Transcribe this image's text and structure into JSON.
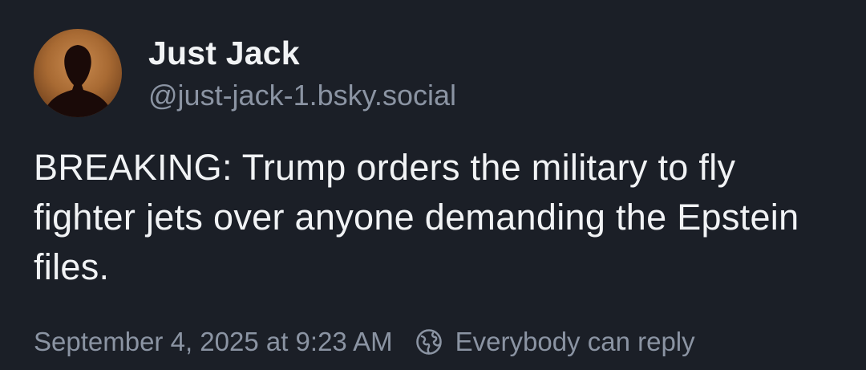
{
  "post": {
    "author": {
      "display_name": "Just Jack",
      "handle": "@just-jack-1.bsky.social",
      "avatar_icon": "person-silhouette-icon"
    },
    "text": "BREAKING: Trump orders the military to fly fighter jets over anyone demanding the Epstein files.",
    "timestamp": "September 4, 2025 at 9:23 AM",
    "reply_setting": {
      "icon": "globe-icon",
      "label": "Everybody can reply"
    }
  },
  "colors": {
    "background": "#1b1f27",
    "primary_text": "#f1f3f5",
    "secondary_text": "#8b94a3"
  }
}
